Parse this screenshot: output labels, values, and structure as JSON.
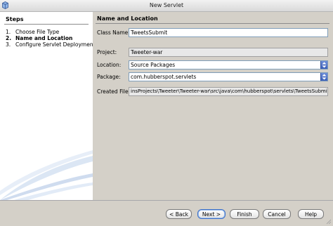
{
  "window": {
    "title": "New Servlet"
  },
  "steps": {
    "title": "Steps",
    "items": [
      {
        "num": "1.",
        "label": "Choose File Type",
        "current": false
      },
      {
        "num": "2.",
        "label": "Name and Location",
        "current": true
      },
      {
        "num": "3.",
        "label": "Configure Servlet Deployment",
        "current": false
      }
    ]
  },
  "panel": {
    "title": "Name and Location",
    "class_name": {
      "label": "Class Name:",
      "value": "TweetsSubmit"
    },
    "project": {
      "label": "Project:",
      "value": "Tweeter-war"
    },
    "location": {
      "label": "Location:",
      "value": "Source Packages"
    },
    "package": {
      "label": "Package:",
      "value": "com.hubberspot.servlets"
    },
    "created_file": {
      "label": "Created File:",
      "value": "insProjects\\Tweeter\\Tweeter-war\\src\\java\\com\\hubberspot\\servlets\\TweetsSubmit.java"
    }
  },
  "buttons": {
    "back": "< Back",
    "next": "Next >",
    "finish": "Finish",
    "cancel": "Cancel",
    "help": "Help"
  },
  "colors": {
    "accent": "#3b5fb8",
    "panel_bg": "#d4d0c8",
    "steps_bg": "#ffffff"
  }
}
